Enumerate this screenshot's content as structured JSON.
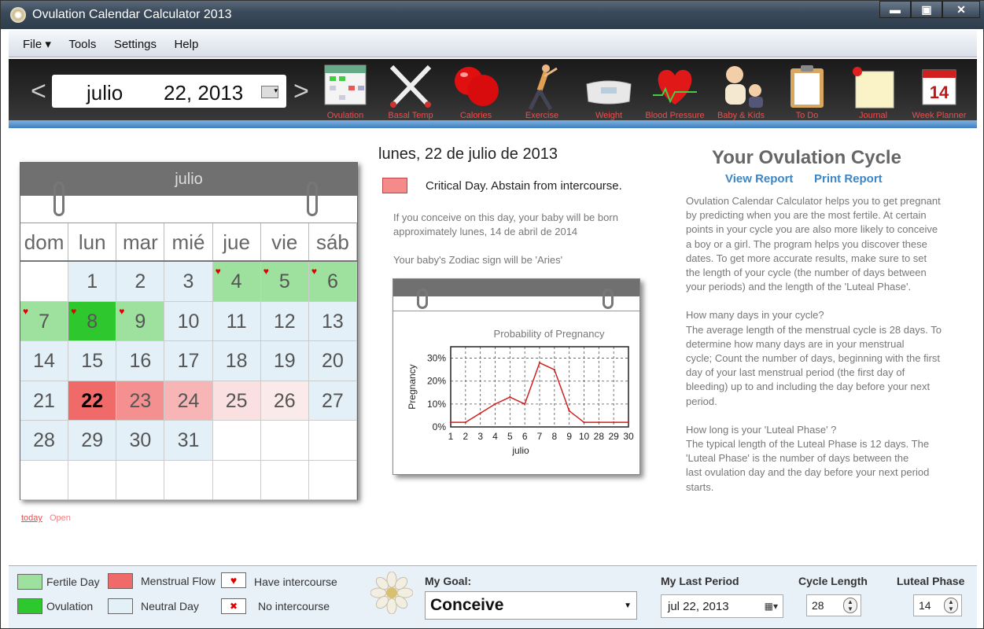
{
  "window": {
    "title": "Ovulation Calendar Calculator 2013",
    "minimize": "▬",
    "maximize": "▣",
    "close": "✕"
  },
  "menu": [
    "File ▾",
    "Tools",
    "Settings",
    "Help"
  ],
  "date_nav": {
    "prev": "<",
    "next": ">",
    "month": "julio",
    "day_year": "22, 2013"
  },
  "tools": [
    {
      "label": "Ovulation",
      "icon": "ovulation-calendar-icon"
    },
    {
      "label": "Basal Temp",
      "icon": "thermometer-icon"
    },
    {
      "label": "Calories",
      "icon": "apple-icon"
    },
    {
      "label": "Exercise",
      "icon": "exercise-icon"
    },
    {
      "label": "Weight",
      "icon": "scale-icon"
    },
    {
      "label": "Blood Pressure",
      "icon": "heart-icon"
    },
    {
      "label": "Baby & Kids",
      "icon": "baby-icon"
    },
    {
      "label": "To Do",
      "icon": "clipboard-icon"
    },
    {
      "label": "Journal",
      "icon": "journal-icon"
    },
    {
      "label": "Week Planner",
      "icon": "week-planner-icon"
    }
  ],
  "calendar": {
    "month": "julio",
    "dow": [
      "dom",
      "lun",
      "mar",
      "mié",
      "jue",
      "vie",
      "sáb"
    ],
    "rows": [
      [
        {
          "d": ""
        },
        {
          "d": "1",
          "t": "neutral"
        },
        {
          "d": "2",
          "t": "neutral"
        },
        {
          "d": "3",
          "t": "neutral"
        },
        {
          "d": "4",
          "t": "fertile",
          "h": true
        },
        {
          "d": "5",
          "t": "fertile",
          "h": true
        },
        {
          "d": "6",
          "t": "fertile",
          "h": true
        }
      ],
      [
        {
          "d": "7",
          "t": "fertile",
          "h": true
        },
        {
          "d": "8",
          "t": "ovul",
          "h": true
        },
        {
          "d": "9",
          "t": "fertile",
          "h": true
        },
        {
          "d": "10",
          "t": "neutral"
        },
        {
          "d": "11",
          "t": "neutral"
        },
        {
          "d": "12",
          "t": "neutral"
        },
        {
          "d": "13",
          "t": "neutral"
        }
      ],
      [
        {
          "d": "14",
          "t": "neutral"
        },
        {
          "d": "15",
          "t": "neutral"
        },
        {
          "d": "16",
          "t": "neutral"
        },
        {
          "d": "17",
          "t": "neutral"
        },
        {
          "d": "18",
          "t": "neutral"
        },
        {
          "d": "19",
          "t": "neutral"
        },
        {
          "d": "20",
          "t": "neutral"
        }
      ],
      [
        {
          "d": "21",
          "t": "neutral"
        },
        {
          "d": "22",
          "t": "mens1",
          "today": true
        },
        {
          "d": "23",
          "t": "mens2"
        },
        {
          "d": "24",
          "t": "mens3"
        },
        {
          "d": "25",
          "t": "mens4"
        },
        {
          "d": "26",
          "t": "mens5"
        },
        {
          "d": "27",
          "t": "neutral"
        }
      ],
      [
        {
          "d": "28",
          "t": "neutral"
        },
        {
          "d": "29",
          "t": "neutral"
        },
        {
          "d": "30",
          "t": "neutral"
        },
        {
          "d": "31",
          "t": "neutral"
        },
        {
          "d": ""
        },
        {
          "d": ""
        },
        {
          "d": ""
        }
      ],
      [
        {
          "d": ""
        },
        {
          "d": ""
        },
        {
          "d": ""
        },
        {
          "d": ""
        },
        {
          "d": ""
        },
        {
          "d": ""
        },
        {
          "d": ""
        }
      ]
    ],
    "heart_glyph": "♥",
    "today_link": "today",
    "open_link": "Open"
  },
  "details": {
    "date_heading": "lunes, 22 de julio de 2013",
    "critical": "Critical Day. Abstain from intercourse.",
    "born_line1": "If you conceive on this day, your baby will be born",
    "born_line2": "approximately lunes, 14 de abril de 2014",
    "zodiac": "Your baby's Zodiac sign will be 'Aries'"
  },
  "chart_data": {
    "type": "line",
    "title": "Probability of Pregnancy",
    "xlabel": "julio",
    "ylabel": "Pregnancy",
    "x": [
      "1",
      "2",
      "3",
      "4",
      "5",
      "6",
      "7",
      "8",
      "9",
      "10",
      "28",
      "29",
      "30"
    ],
    "values": [
      2,
      2,
      6,
      10,
      13,
      10,
      28,
      25,
      7,
      2,
      2,
      2,
      2
    ],
    "ylim": [
      0,
      35
    ],
    "yticks": [
      "0%",
      "10%",
      "20%",
      "30%"
    ],
    "color": "#d02020",
    "grid": true
  },
  "right": {
    "title": "Your Ovulation Cycle",
    "view_report": "View Report",
    "print_report": "Print Report",
    "para1": [
      "Ovulation Calendar Calculator helps you to get pregnant",
      "by predicting when you are the most fertile. At certain",
      "points in your cycle you are also more likely to conceive",
      "a boy or a girl. The program helps you discover these",
      "dates. To get more accurate results, make sure to set",
      "the length of your cycle (the number of days between",
      "your periods) and the length of the 'Luteal Phase'."
    ],
    "para2": [
      "How many days in your cycle?",
      "The average length of the menstrual cycle is 28 days. To",
      "determine how many days are in your menstrual",
      "cycle; Count the number of days, beginning with the first",
      "day of your last menstrual period (the first day of",
      "bleeding) up to and including the day before your next",
      "period."
    ],
    "para3": [
      "How long is your 'Luteal Phase' ?",
      "The typical length of the Luteal Phase is 12 days. The",
      "'Luteal Phase' is the number of days between the",
      "last ovulation day and the day before your next period",
      "starts."
    ]
  },
  "legend": {
    "fertile": "Fertile Day",
    "ovulation": "Ovulation",
    "menstrual": "Menstrual Flow",
    "neutral": "Neutral Day",
    "have": "Have intercourse",
    "no": "No intercourse",
    "have_glyph": "♥",
    "no_glyph": "✖"
  },
  "footer": {
    "goal_label": "My Goal:",
    "goal_value": "Conceive",
    "last_period_label": "My Last Period",
    "last_period_value": "jul  22, 2013",
    "cycle_label": "Cycle Length",
    "cycle_value": "28",
    "luteal_label": "Luteal Phase",
    "luteal_value": "14"
  }
}
